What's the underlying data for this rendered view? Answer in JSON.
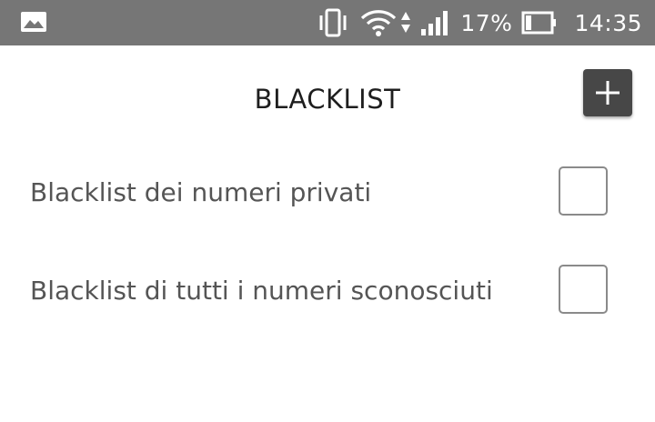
{
  "status_bar": {
    "battery_percent": "17%",
    "time": "14:35",
    "icons": [
      "image-notification-icon",
      "vibrate-icon",
      "wifi-icon",
      "signal-icon",
      "battery-icon"
    ],
    "background_color": "#767676"
  },
  "header": {
    "title": "BLACKLIST",
    "add_button_icon": "plus-icon"
  },
  "options": [
    {
      "label": "Blacklist dei numeri privati",
      "checked": false
    },
    {
      "label": "Blacklist di tutti i numeri sconosciuti",
      "checked": false
    }
  ]
}
